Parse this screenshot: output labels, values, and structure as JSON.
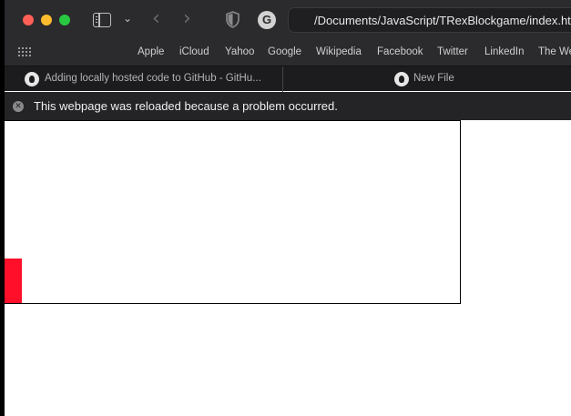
{
  "browser": {
    "url": "/Documents/JavaScript/TRexBlockgame/index.html",
    "favorites": [
      "Apple",
      "iCloud",
      "Yahoo",
      "Google",
      "Wikipedia",
      "Facebook",
      "Twitter",
      "LinkedIn",
      "The Weather Channel"
    ]
  },
  "tabs": [
    {
      "label": "Adding locally hosted code to GitHub - GitHu..."
    },
    {
      "label": "New File"
    }
  ],
  "banner": {
    "message": "This webpage was reloaded because a problem occurred."
  },
  "game": {
    "player_color": "#ff0f2a"
  }
}
